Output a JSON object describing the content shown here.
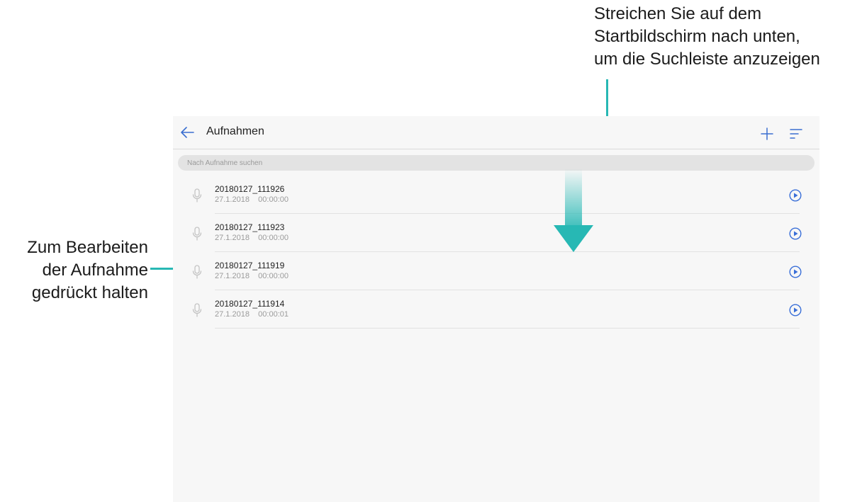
{
  "annotations": {
    "top_lines": [
      "Streichen Sie auf dem",
      "Startbildschirm nach unten,",
      "um die Suchleiste anzuzeigen"
    ],
    "left_lines": [
      "Zum Bearbeiten",
      "der Aufnahme",
      "gedrückt halten"
    ],
    "accent_color": "#27b8b4"
  },
  "appbar": {
    "back_icon": "arrow-left-icon",
    "title": "Aufnahmen",
    "add_icon": "plus-icon",
    "sort_icon": "sort-icon"
  },
  "search": {
    "placeholder": "Nach Aufnahme suchen"
  },
  "recordings": [
    {
      "name": "20180127_111926",
      "date": "27.1.2018",
      "duration": "00:00:00"
    },
    {
      "name": "20180127_111923",
      "date": "27.1.2018",
      "duration": "00:00:00"
    },
    {
      "name": "20180127_111919",
      "date": "27.1.2018",
      "duration": "00:00:00"
    },
    {
      "name": "20180127_111914",
      "date": "27.1.2018",
      "duration": "00:00:01"
    }
  ],
  "icons": {
    "row_icon": "microphone-icon",
    "row_action": "play-circle-icon",
    "gesture": "swipe-down-arrow-icon"
  },
  "colors": {
    "accent": "#27b8b4",
    "play": "#3a6fd8",
    "screen_bg": "#f7f7f7"
  }
}
